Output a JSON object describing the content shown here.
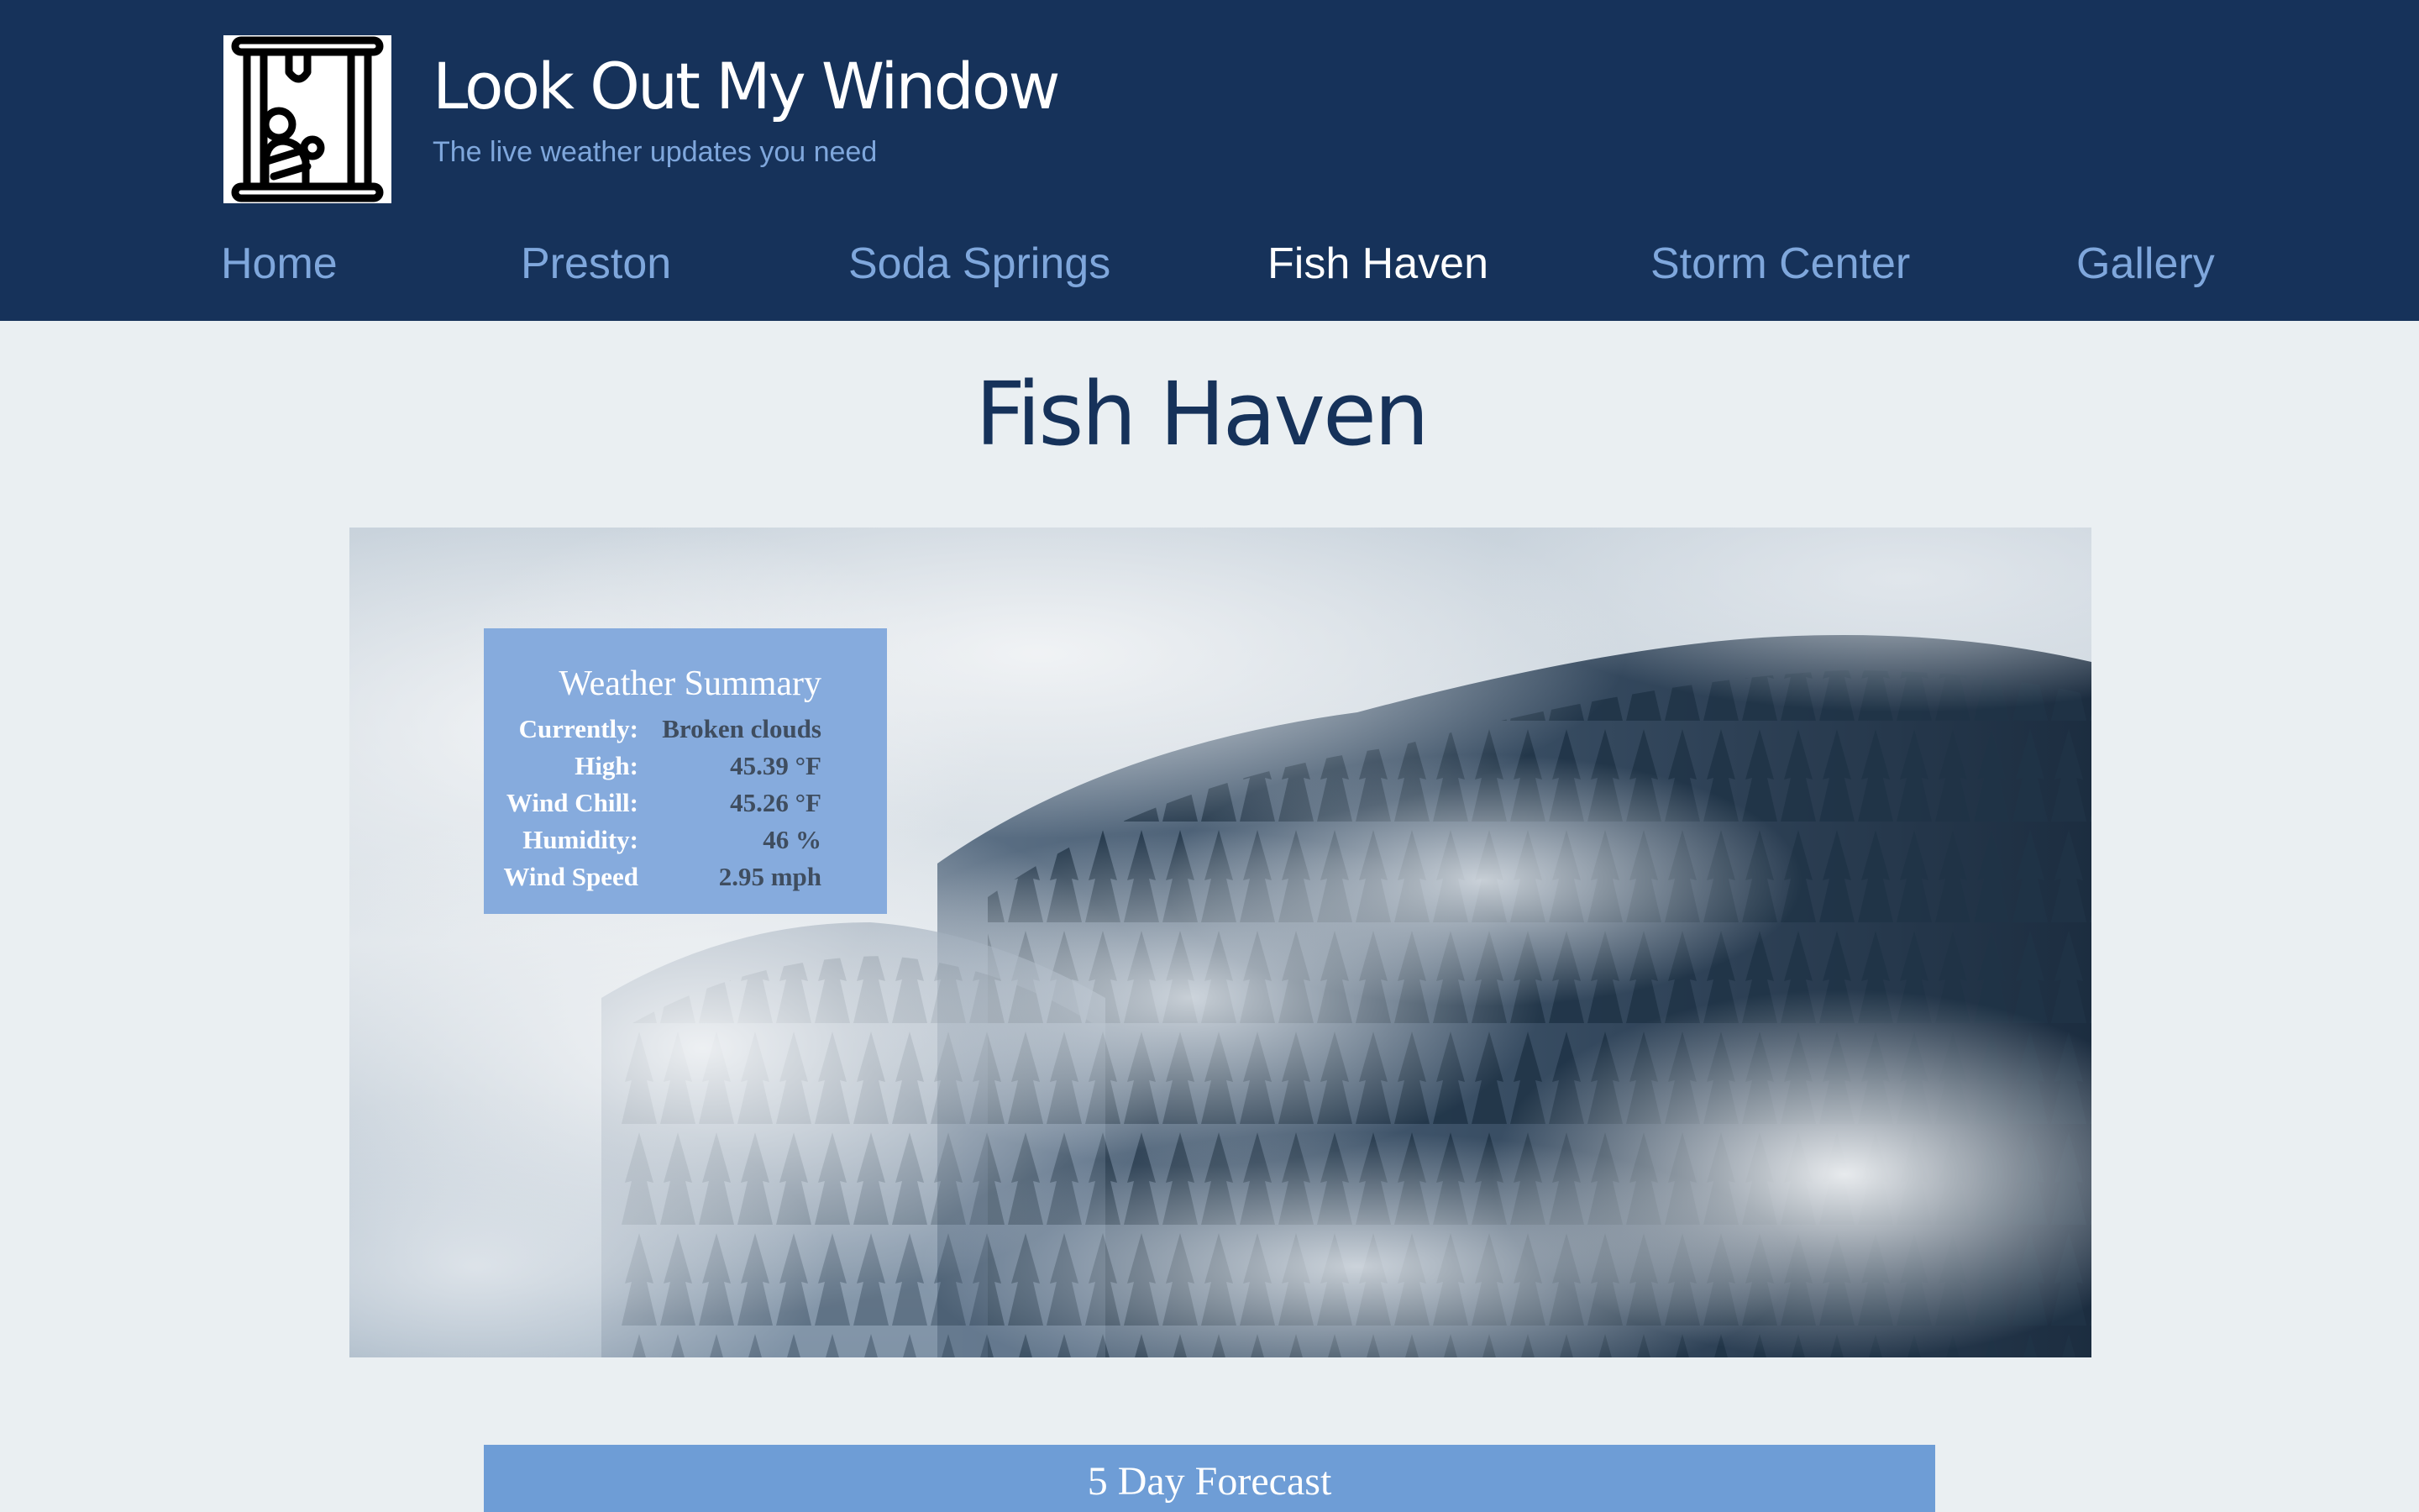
{
  "site": {
    "title": "Look Out My Window",
    "tagline": "The live weather updates you need"
  },
  "nav": {
    "items": [
      {
        "label": "Home"
      },
      {
        "label": "Preston"
      },
      {
        "label": "Soda Springs"
      },
      {
        "label": "Fish Haven",
        "active": true
      },
      {
        "label": "Storm Center"
      },
      {
        "label": "Gallery"
      }
    ]
  },
  "page": {
    "title": "Fish Haven"
  },
  "weather_summary": {
    "title": "Weather Summary",
    "rows": [
      {
        "label": "Currently:",
        "value": "Broken clouds"
      },
      {
        "label": "High:",
        "value": "45.39 °F"
      },
      {
        "label": "Wind Chill:",
        "value": "45.26 °F"
      },
      {
        "label": "Humidity:",
        "value": "46 %"
      },
      {
        "label": "Wind Speed",
        "value": "2.95 mph"
      }
    ]
  },
  "forecast": {
    "title": "5 Day Forecast"
  },
  "colors": {
    "header_bg": "#16325a",
    "nav_link": "#7fa7dc",
    "nav_active": "#ffffff",
    "page_bg": "#eaeff2",
    "summary_bg": "#86abdd",
    "forecast_bg": "#6e9dd6"
  },
  "icons": {
    "logo": "person-at-window-icon"
  }
}
